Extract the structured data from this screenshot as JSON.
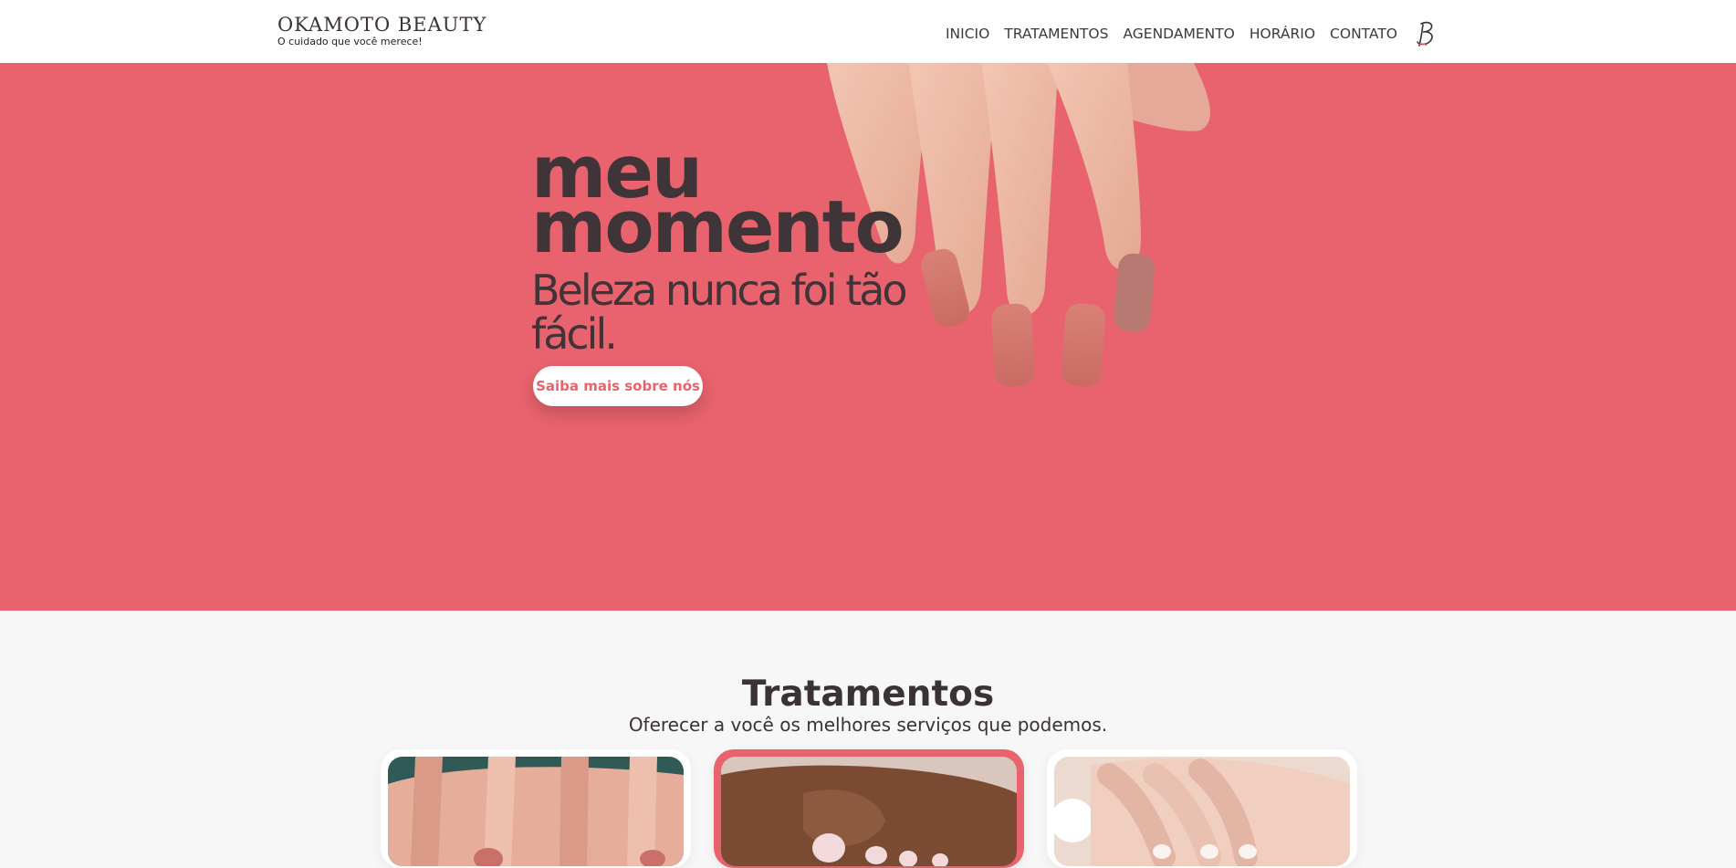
{
  "header": {
    "brand_name": "OKAMOTO BEAUTY",
    "brand_tagline": "O cuidado que você merece!",
    "nav": [
      "INICIO",
      "TRATAMENTOS",
      "AGENDAMENTO",
      "HORÁRIO",
      "CONTATO"
    ],
    "monogram_icon": "monogram-b-icon"
  },
  "hero": {
    "title_line1": "meu",
    "title_line2": "momento",
    "subtitle": "Beleza nunca foi tão fácil.",
    "button_label": "Saiba mais sobre nós",
    "background_color": "#e8636d"
  },
  "treatments": {
    "title": "Tratamentos",
    "subtitle": "Oferecer a você os melhores serviços que podemos.",
    "cards": [
      {
        "image": "manicure-photo"
      },
      {
        "image": "pedicure-photo",
        "active": true
      },
      {
        "image": "french-nails-photo"
      }
    ]
  },
  "colors": {
    "accent": "#e8636d",
    "text_dark": "#3f3437",
    "background": "#f7f7f7"
  }
}
